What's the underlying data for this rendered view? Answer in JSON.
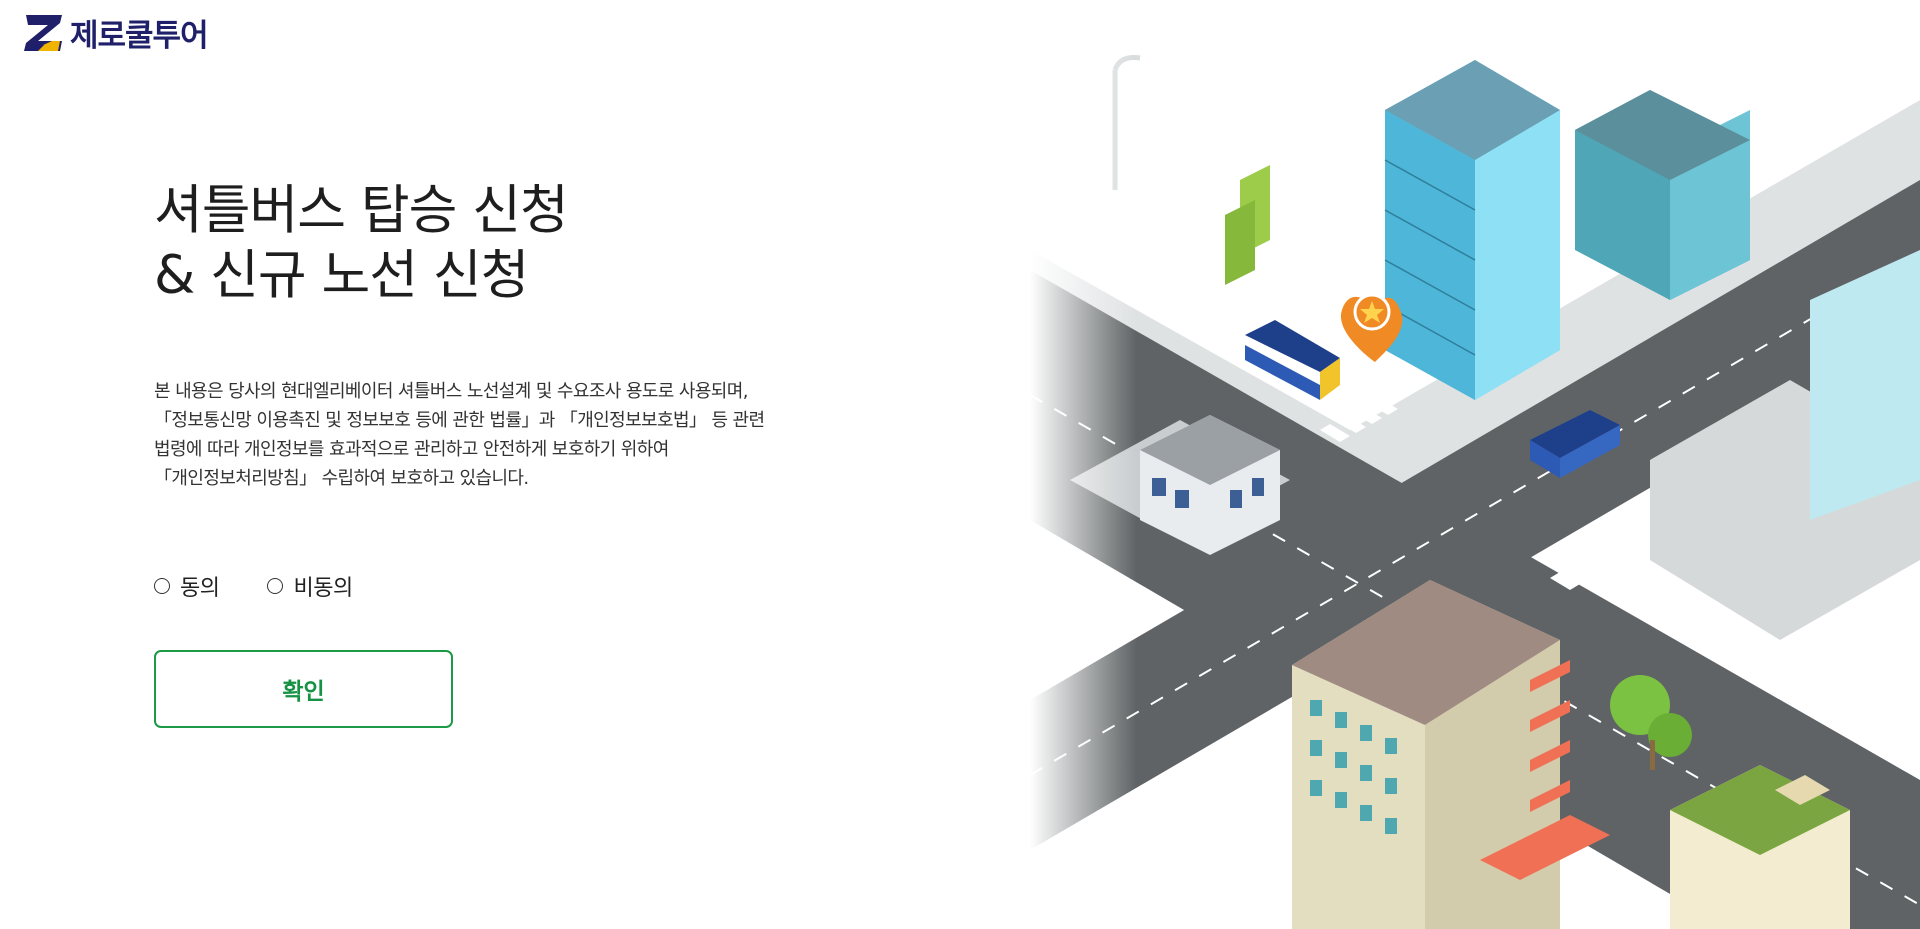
{
  "brand": {
    "logo_text": "제로쿨투어",
    "primary_color": "#20206a",
    "accent_color": "#f0b400"
  },
  "page": {
    "title_line1": "셔틀버스 탑승 신청",
    "title_line2": "& 신규 노선 신청",
    "description_lines": [
      "본 내용은 당사의 현대엘리베이터 셔틀버스 노선설계 및 수요조사 용도로 사용되며,",
      "「정보통신망 이용촉진 및 정보보호 등에 관한 법률」과 「개인정보보호법」 등 관련",
      "법령에 따라 개인정보를 효과적으로 관리하고 안전하게 보호하기 위하여",
      "「개인정보처리방침」 수립하여 보호하고 있습니다."
    ]
  },
  "consent": {
    "agree_label": "동의",
    "disagree_label": "비동의",
    "selected": null
  },
  "confirm_button": {
    "label": "확인",
    "color": "#1c9a45"
  },
  "illustration": {
    "icon": "city-isometric-illustration",
    "pin_icon": "location-star-pin-icon"
  }
}
